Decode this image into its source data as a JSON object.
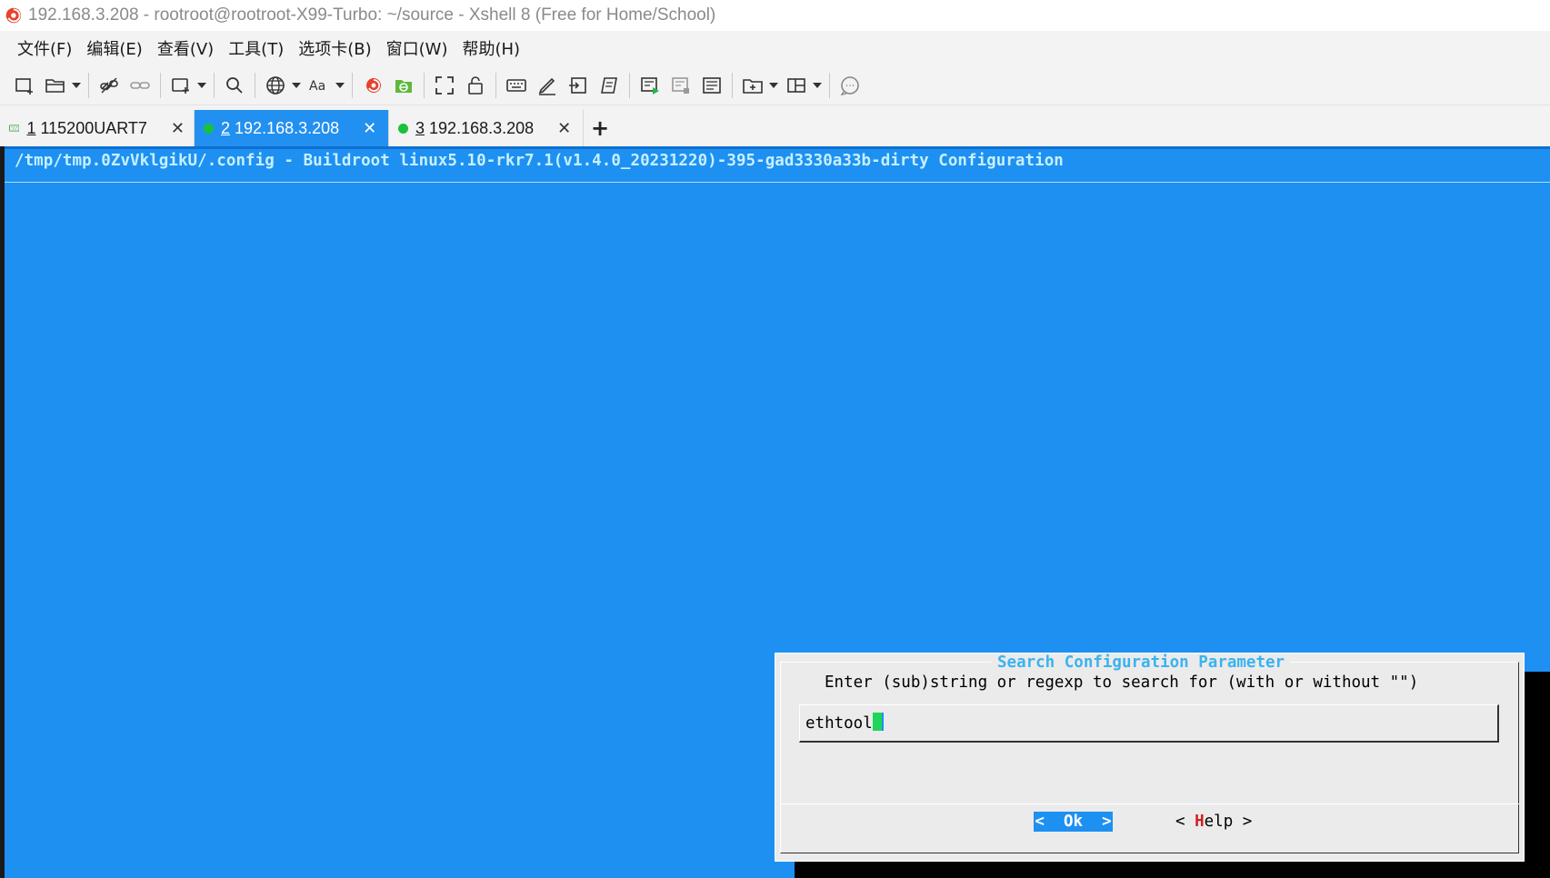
{
  "window": {
    "title": "192.168.3.208 - rootroot@rootroot-X99-Turbo: ~/source - Xshell 8 (Free for Home/School)"
  },
  "menu": {
    "items": [
      "文件(F)",
      "编辑(E)",
      "查看(V)",
      "工具(T)",
      "选项卡(B)",
      "窗口(W)",
      "帮助(H)"
    ]
  },
  "toolbar": {
    "icons": [
      "new-session-icon",
      "open-folder-icon",
      "disconnect-icon",
      "link-icon",
      "new-window-icon",
      "search-icon",
      "globe-icon",
      "font-icon",
      "xshell-icon",
      "xftp-icon",
      "fullscreen-icon",
      "lock-icon",
      "keyboard-icon",
      "pen-icon",
      "login-icon",
      "script-icon",
      "start-recording-icon",
      "stop-recording-icon",
      "notes-icon",
      "new-tab-icon",
      "layout-icon",
      "chat-icon"
    ]
  },
  "tabs": [
    {
      "num": "1",
      "label": "115200UART7",
      "active": false,
      "status": "serial"
    },
    {
      "num": "2",
      "label": "192.168.3.208",
      "active": true,
      "status": "connected"
    },
    {
      "num": "3",
      "label": "192.168.3.208",
      "active": false,
      "status": "connected"
    }
  ],
  "tab_close": "✕",
  "tab_add": "+",
  "terminal": {
    "header": "/tmp/tmp.0ZvVklgikU/.config - Buildroot linux5.10-rkr7.1(v1.4.0_20231220)-395-gad3330a33b-dirty Configuration",
    "dialog": {
      "title": "Search Configuration Parameter",
      "prompt": "Enter (sub)string or regexp to search for (with or without \"\")",
      "input_value": "ethtool",
      "ok_label": "<  Ok  >",
      "help_prefix": "< ",
      "help_hotkey": "H",
      "help_rest": "elp >"
    }
  },
  "colors": {
    "terminal_bg": "#1e90f2",
    "active_tab": "#2290f0",
    "dialog_bg": "#ebebeb",
    "dialog_title": "#3ab3f0",
    "status_dot": "#19c23a"
  }
}
